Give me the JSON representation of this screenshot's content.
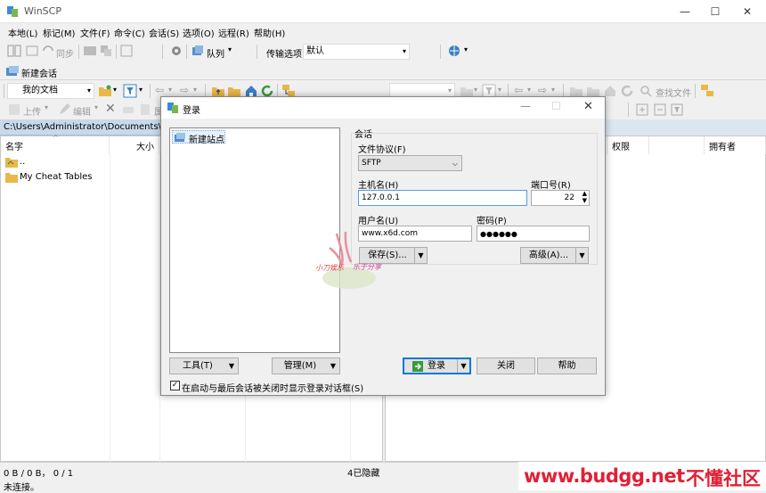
{
  "window": {
    "title": "WinSCP",
    "minimize": "—",
    "maximize": "☐",
    "close": "✕"
  },
  "menu": [
    "本地(L)",
    "标记(M)",
    "文件(F)",
    "命令(C)",
    "会话(S)",
    "选项(O)",
    "远程(R)",
    "帮助(H)"
  ],
  "toolbar1": {
    "sync": "同步",
    "queue": "队列",
    "transfer_options": "传输选项",
    "transfer_default": "默认"
  },
  "session_tab": {
    "new_session": "新建会话"
  },
  "left_toolbar": {
    "location": "我的文档",
    "upload": "上传",
    "edit": "编辑",
    "properties": "属性"
  },
  "right_toolbar": {
    "find_files": "查找文件"
  },
  "left_panel": {
    "path": "C:\\Users\\Administrator\\Documents\\",
    "col_name": "名字",
    "col_size": "大小",
    "items": [
      {
        "name": ".."
      },
      {
        "name": "My Cheat Tables"
      }
    ]
  },
  "right_panel": {
    "col_rights": "权限",
    "col_owner": "拥有者"
  },
  "status": {
    "transfer": "0 B / 0 B， 0 / 1",
    "hidden": "4已隐藏",
    "connection": "未连接。"
  },
  "dialog": {
    "title": "登录",
    "site_list": [
      "新建站点"
    ],
    "group_label": "会话",
    "protocol_label": "文件协议(F)",
    "protocol_value": "SFTP",
    "host_label": "主机名(H)",
    "host_value": "127.0.0.1",
    "port_label": "端口号(R)",
    "port_value": "22",
    "user_label": "用户名(U)",
    "user_value": "www.x6d.com",
    "password_label": "密码(P)",
    "password_value": "●●●●●●",
    "save_button": "保存(S)...",
    "advanced_button": "高级(A)...",
    "tools_button": "工具(T)",
    "manage_button": "管理(M)",
    "login_button": "登录",
    "close_button": "关闭",
    "help_button": "帮助",
    "checkbox_label": "在启动与最后会话被关闭时显示登录对话框(S)"
  },
  "stamp": {
    "line1": "小刀娱乐",
    "line2": "乐于分享"
  },
  "watermark": {
    "site": "www.budgg.net",
    "cn": "不懂社区"
  },
  "colors": {
    "accent": "#2b579a",
    "pathbar": "#c7d9ea",
    "watermark": "#e02035",
    "folder": "#e8b84a"
  }
}
